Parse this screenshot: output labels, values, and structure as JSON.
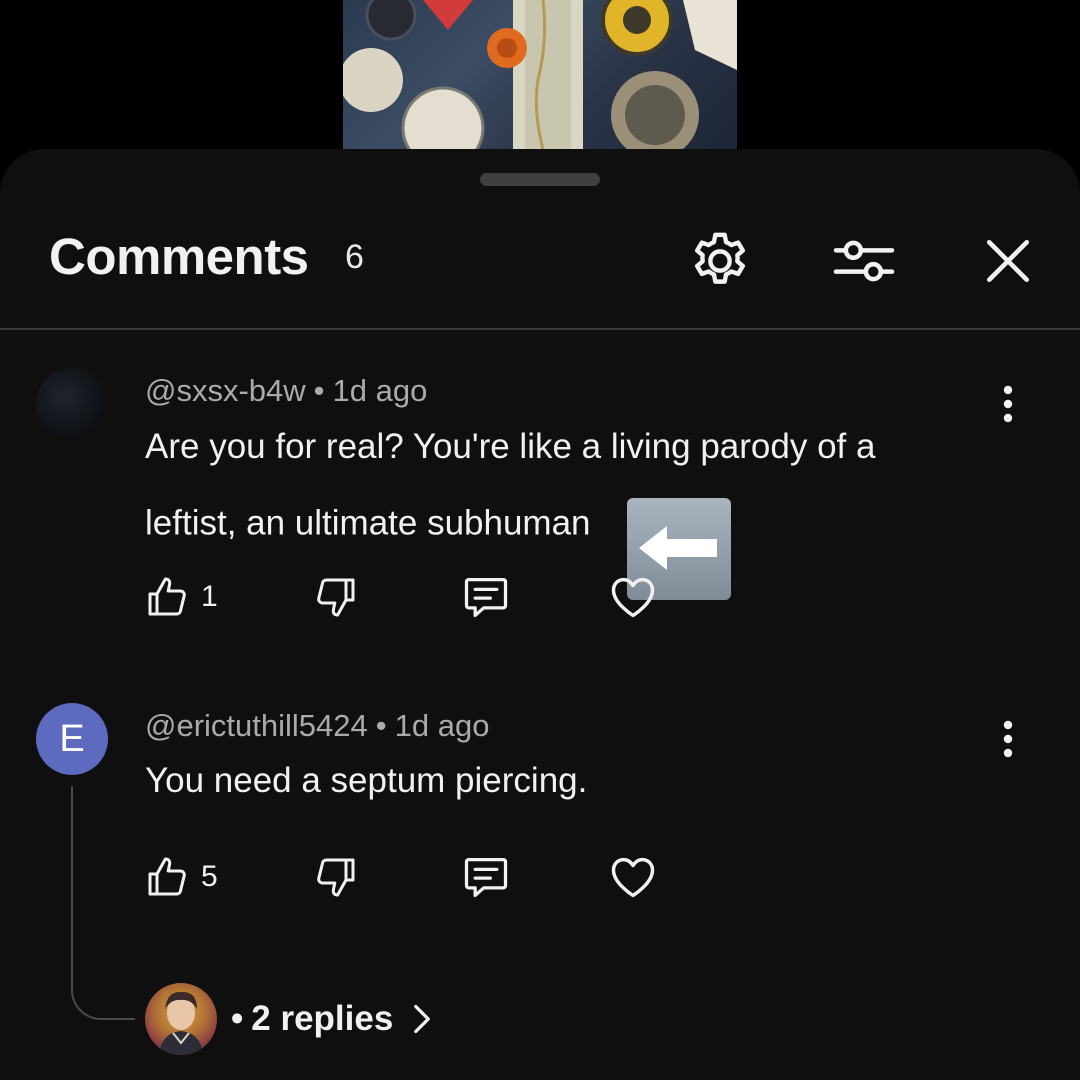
{
  "header": {
    "title": "Comments",
    "count": "6"
  },
  "comments": [
    {
      "handle": "@sxsx-b4w",
      "separator": "•",
      "time": "1d ago",
      "text": "Are you for real? You're like a living parody of a leftist, an ultimate subhuman",
      "emoji": "left-arrow-emoji",
      "likes": "1",
      "avatar_letter": ""
    },
    {
      "handle": "@erictuthill5424",
      "separator": "•",
      "time": "1d ago",
      "text": "You need a septum piercing.",
      "likes": "5",
      "avatar_letter": "E"
    }
  ],
  "replies": {
    "separator": "•",
    "label": "2 replies"
  },
  "colors": {
    "sheet_bg": "#0f0f0f",
    "avatar_letter_bg": "#5c6bc0",
    "secondary_text": "#aaaaaa",
    "primary_text": "#f1f1f1"
  }
}
